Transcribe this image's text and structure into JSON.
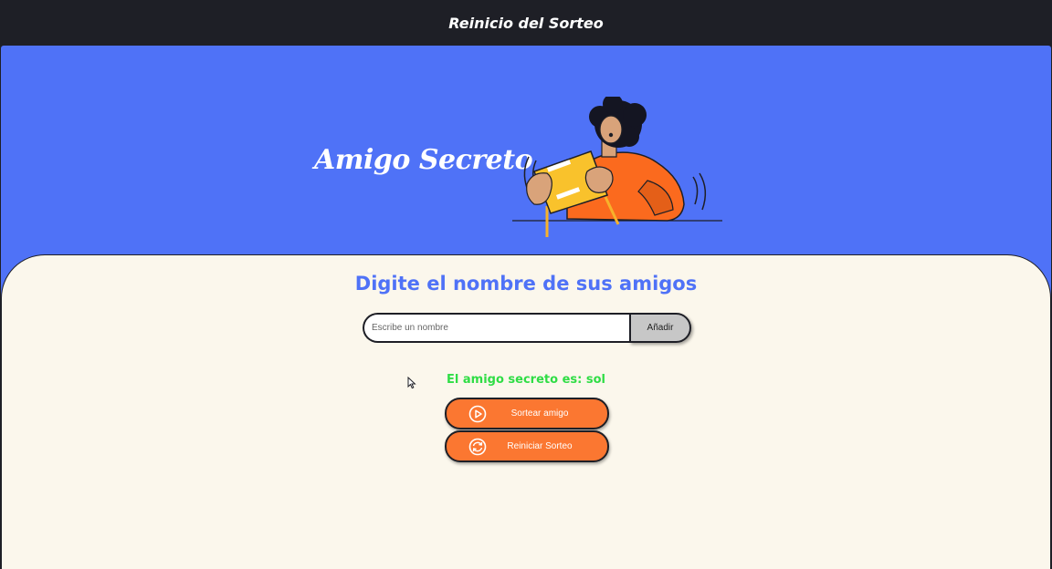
{
  "topbar": {
    "title": "Reinicio del Sorteo"
  },
  "hero": {
    "title": "Amigo Secreto"
  },
  "form": {
    "heading": "Digite el nombre de sus amigos",
    "input_placeholder": "Escribe un nombre",
    "input_value": "",
    "add_label": "Añadir"
  },
  "result": {
    "text": "El amigo secreto es: sol"
  },
  "actions": {
    "draw_label": "Sortear amigo",
    "draw_icon": "play-circle-icon",
    "reset_label": "Reiniciar Sorteo",
    "reset_icon": "refresh-icon"
  },
  "colors": {
    "background_dark": "#1e1f26",
    "hero_blue": "#4f72f7",
    "panel_cream": "#fbf7ec",
    "heading_blue": "#4f72f7",
    "result_green": "#2fdd45",
    "button_orange": "#fb7731",
    "add_button_gray": "#c7c7c7"
  }
}
